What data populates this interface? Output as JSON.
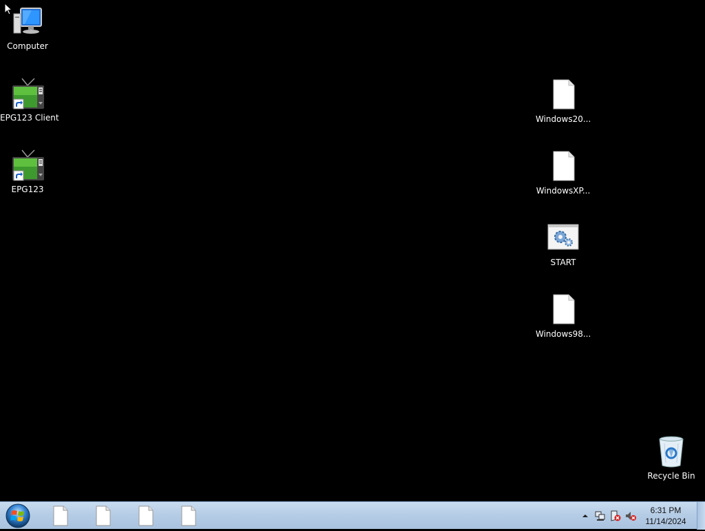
{
  "desktop": {
    "icons": {
      "computer": {
        "label": "Computer",
        "icon": "computer-icon"
      },
      "epg123_client": {
        "label": "EPG123 Client",
        "icon": "tv-shortcut-icon"
      },
      "epg123": {
        "label": "EPG123",
        "icon": "tv-shortcut-icon"
      },
      "windows20": {
        "label": "Windows20...",
        "icon": "blank-file-icon"
      },
      "windowsxp": {
        "label": "WindowsXP...",
        "icon": "blank-file-icon"
      },
      "start": {
        "label": "START",
        "icon": "batch-file-icon"
      },
      "windows98": {
        "label": "Windows98...",
        "icon": "blank-file-icon"
      },
      "recycle_bin": {
        "label": "Recycle Bin",
        "icon": "recycle-bin-icon"
      }
    }
  },
  "taskbar": {
    "start_icon": "windows-orb-icon",
    "items": [
      "blank-file-icon",
      "blank-file-icon",
      "blank-file-icon",
      "blank-file-icon"
    ],
    "tray": {
      "icons": [
        "chevron-up-icon",
        "network-icon",
        "action-center-icon",
        "volume-muted-icon"
      ],
      "time": "6:31 PM",
      "date": "11/14/2024"
    }
  },
  "colors": {
    "desktop_background": "#000000",
    "taskbar": "#b6cde6"
  }
}
